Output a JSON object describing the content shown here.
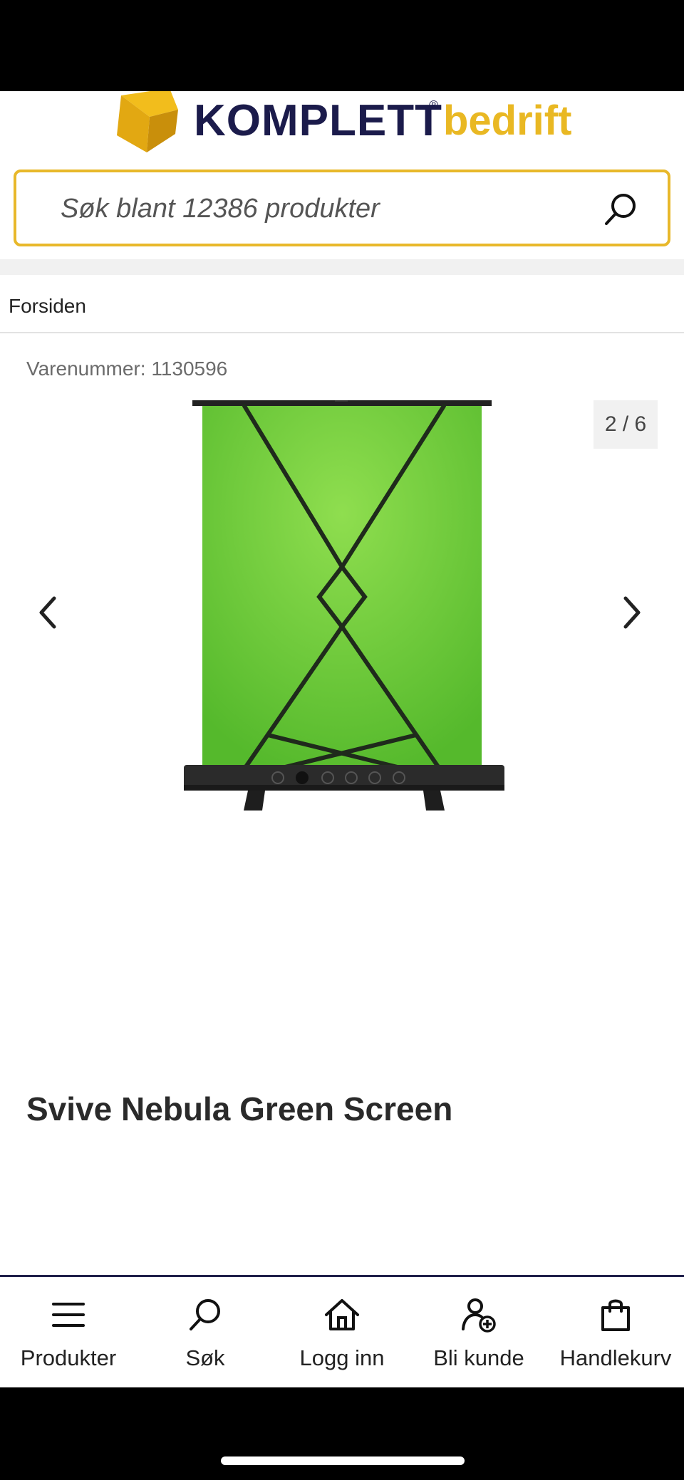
{
  "header": {
    "brand_name": "KOMPLETT",
    "brand_mark": "®",
    "brand_sub": "bedrift",
    "colors": {
      "brand_dark": "#1b1b4b",
      "brand_yellow": "#e9b823"
    }
  },
  "search": {
    "placeholder": "Søk blant 12386 produkter",
    "icon": "search-icon"
  },
  "breadcrumb": {
    "home": "Forsiden"
  },
  "product": {
    "sku_label": "Varenummer: 1130596",
    "title": "Svive Nebula Green Screen",
    "gallery": {
      "counter": "2 / 6",
      "prev_icon": "chevron-left-icon",
      "next_icon": "chevron-right-icon"
    }
  },
  "bottom_nav": {
    "items": [
      {
        "label": "Produkter",
        "icon": "menu-icon"
      },
      {
        "label": "Søk",
        "icon": "search-icon"
      },
      {
        "label": "Logg inn",
        "icon": "home-icon"
      },
      {
        "label": "Bli kunde",
        "icon": "add-user-icon"
      },
      {
        "label": "Handlekurv",
        "icon": "shopping-bag-icon"
      }
    ]
  }
}
